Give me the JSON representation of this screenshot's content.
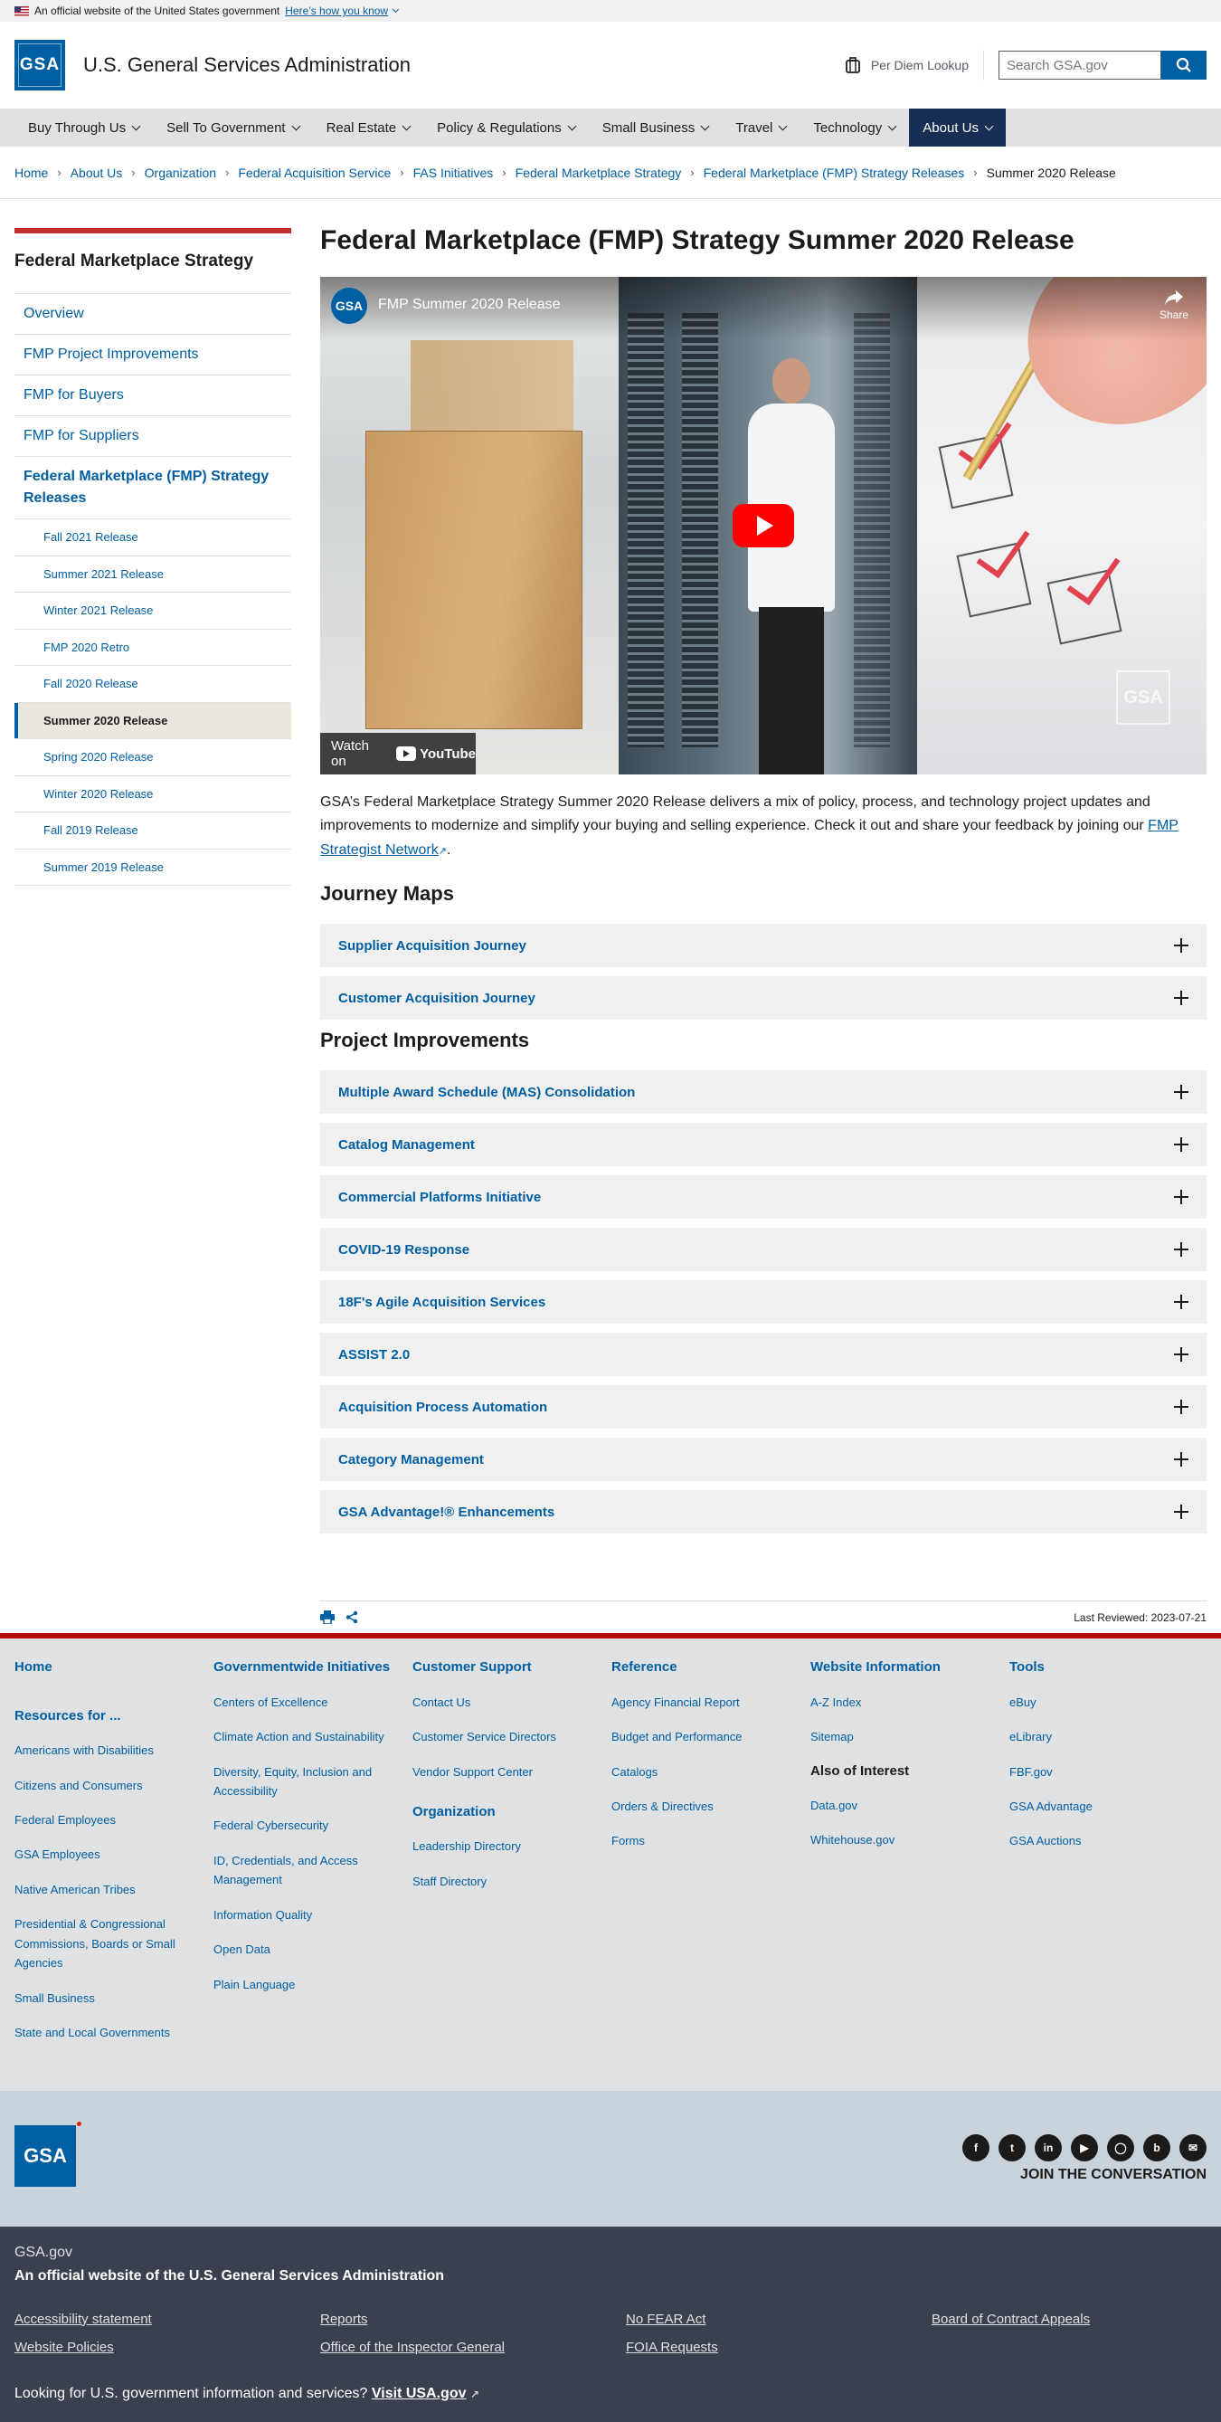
{
  "banner": {
    "text": "An official website of the United States government",
    "how": "Here’s how you know"
  },
  "header": {
    "logo": "GSA",
    "site_name": "U.S. General Services Administration",
    "perdiem": "Per Diem Lookup",
    "search_placeholder": "Search GSA.gov"
  },
  "nav": [
    {
      "label": "Buy Through Us"
    },
    {
      "label": "Sell To Government"
    },
    {
      "label": "Real Estate"
    },
    {
      "label": "Policy & Regulations"
    },
    {
      "label": "Small Business"
    },
    {
      "label": "Travel"
    },
    {
      "label": "Technology"
    },
    {
      "label": "About Us",
      "active": true
    }
  ],
  "breadcrumb": [
    "Home",
    "About Us",
    "Organization",
    "Federal Acquisition Service",
    "FAS Initiatives",
    "Federal Marketplace Strategy",
    "Federal Marketplace (FMP) Strategy Releases"
  ],
  "breadcrumb_current": "Summer 2020 Release",
  "sidenav": {
    "title": "Federal Marketplace Strategy",
    "items": [
      "Overview",
      "FMP Project Improvements",
      "FMP for Buyers",
      "FMP for Suppliers"
    ],
    "section": "Federal Marketplace (FMP) Strategy Releases",
    "sub": [
      "Fall 2021 Release",
      "Summer 2021 Release",
      "Winter 2021 Release",
      "FMP 2020 Retro",
      "Fall 2020 Release",
      "Summer 2020 Release",
      "Spring 2020 Release",
      "Winter 2020 Release",
      "Fall 2019 Release",
      "Summer 2019 Release"
    ],
    "current": "Summer 2020 Release"
  },
  "page": {
    "title": "Federal Marketplace (FMP) Strategy Summer 2020 Release",
    "video": {
      "channel": "GSA",
      "title": "FMP Summer 2020 Release",
      "share": "Share",
      "watch_on": "Watch on",
      "youtube": "YouTube",
      "watermark": "GSA"
    },
    "intro": "GSA’s Federal Marketplace Strategy Summer 2020 Release delivers a mix of policy, process, and technology project updates and improvements to modernize and simplify your buying and selling experience. Check it out and share your feedback by joining our ",
    "intro_link": "FMP Strategist Network",
    "journey_heading": "Journey Maps",
    "journey": [
      "Supplier Acquisition Journey",
      "Customer Acquisition Journey"
    ],
    "projects_heading": "Project Improvements",
    "projects": [
      "Multiple Award Schedule (MAS) Consolidation",
      "Catalog Management",
      "Commercial Platforms Initiative",
      "COVID-19 Response",
      "18F's Agile Acquisition Services",
      "ASSIST 2.0",
      "Acquisition Process Automation",
      "Category Management",
      "GSA Advantage!® Enhancements"
    ],
    "last_reviewed": "Last Reviewed: 2023-07-21"
  },
  "footer": {
    "col1": {
      "home": "Home",
      "resources_heading": "Resources for ...",
      "links": [
        "Americans with Disabilities",
        "Citizens and Consumers",
        "Federal Employees",
        "GSA Employees",
        "Native American Tribes",
        "Presidential & Congressional Commissions, Boards or Small Agencies",
        "Small Business",
        "State and Local Governments"
      ]
    },
    "col2": {
      "heading": "Governmentwide Initiatives",
      "links": [
        "Centers of Excellence",
        "Climate Action and Sustainability",
        "Diversity, Equity, Inclusion and Accessibility",
        "Federal Cybersecurity",
        "ID, Credentials, and Access Management",
        "Information Quality",
        "Open Data",
        "Plain Language"
      ]
    },
    "col3": {
      "heading": "Customer Support",
      "links": [
        "Contact Us",
        "Customer Service Directors",
        "Vendor Support Center"
      ],
      "heading2": "Organization",
      "links2": [
        "Leadership Directory",
        "Staff Directory"
      ]
    },
    "col4": {
      "heading": "Reference",
      "links": [
        "Agency Financial Report",
        "Budget and Performance",
        "Catalogs",
        "Orders & Directives",
        "Forms"
      ]
    },
    "col5": {
      "heading": "Website Information",
      "links": [
        "A-Z Index",
        "Sitemap"
      ],
      "heading2": "Also of Interest",
      "links2": [
        "Data.gov",
        "Whitehouse.gov"
      ]
    },
    "col6": {
      "heading": "Tools",
      "links": [
        "eBuy",
        "eLibrary",
        "FBF.gov",
        "GSA Advantage",
        "GSA Auctions"
      ]
    },
    "logo": "GSA",
    "join": "JOIN THE CONVERSATION",
    "social": [
      "facebook-icon",
      "twitter-icon",
      "linkedin-icon",
      "youtube-icon",
      "instagram-icon",
      "blog-icon",
      "email-icon"
    ]
  },
  "identifier": {
    "domain": "GSA.gov",
    "official": "An official website of the U.S. General Services Administration",
    "links": [
      "Accessibility statement",
      "Reports",
      "No FEAR Act",
      "Board of Contract Appeals",
      "Website Policies",
      "Office of the Inspector General",
      "FOIA Requests"
    ],
    "usagov_text": "Looking for U.S. government information and services?",
    "usagov_link": "Visit USA.gov"
  }
}
